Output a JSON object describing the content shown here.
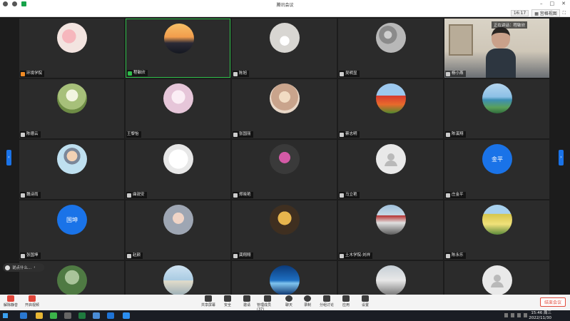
{
  "window": {
    "title": "腾讯会议"
  },
  "topbar": {
    "time": "16:17",
    "view_label": "宫格视图"
  },
  "speaking": {
    "label": "正在讲话：程敏欣"
  },
  "participants": [
    {
      "name": "环境学院",
      "avatar": "pigs",
      "mic": "orange"
    },
    {
      "name": "程敏欣",
      "avatar": "sunset",
      "mic": "green",
      "speaking": true
    },
    {
      "name": "陈旭",
      "avatar": "shell",
      "mic": "gray"
    },
    {
      "name": "吴明显",
      "avatar": "rocks",
      "mic": "gray"
    },
    {
      "name": "杨小燕",
      "avatar": "video",
      "mic": "gray"
    },
    {
      "name": "陈德云",
      "avatar": "flowers",
      "mic": "gray"
    },
    {
      "name": "王黎怡",
      "avatar": "girl",
      "mic": "none"
    },
    {
      "name": "张国丽",
      "avatar": "woman-hat",
      "mic": "gray"
    },
    {
      "name": "蔡志明",
      "avatar": "tulips",
      "mic": "gray"
    },
    {
      "name": "陈溪翔",
      "avatar": "lake",
      "mic": "gray"
    },
    {
      "name": "魏诗雨",
      "avatar": "cartoon-man",
      "mic": "gray"
    },
    {
      "name": "曲锐安",
      "avatar": "cartoon-cat",
      "mic": "gray"
    },
    {
      "name": "郑晓艳",
      "avatar": "orchid",
      "mic": "gray"
    },
    {
      "name": "马立艳",
      "avatar": "placeholder",
      "mic": "gray"
    },
    {
      "name": "庄金平",
      "avatar": "text",
      "avatar_text": "金平",
      "mic": "gray"
    },
    {
      "name": "张国坤",
      "avatar": "text",
      "avatar_text": "国坤",
      "mic": "gray"
    },
    {
      "name": "赵颜",
      "avatar": "baby",
      "mic": "gray"
    },
    {
      "name": "龚翔翔",
      "avatar": "kid",
      "mic": "gray"
    },
    {
      "name": "土木学院-刘祥",
      "avatar": "train",
      "mic": "gray"
    },
    {
      "name": "陈永乐",
      "avatar": "bus",
      "mic": "gray"
    },
    {
      "name": "",
      "avatar": "trees",
      "mic": "none"
    },
    {
      "name": "",
      "avatar": "landscape",
      "mic": "none"
    },
    {
      "name": "",
      "avatar": "ocean",
      "mic": "none"
    },
    {
      "name": "",
      "avatar": "street",
      "mic": "none"
    },
    {
      "name": "",
      "avatar": "placeholder",
      "mic": "none"
    }
  ],
  "side_panel": {
    "label": "说点什么..."
  },
  "toolbar": {
    "left": [
      {
        "label": "解除静音"
      },
      {
        "label": "开启视频"
      }
    ],
    "center": [
      {
        "label": "共享屏幕"
      },
      {
        "label": "安全"
      },
      {
        "label": "邀请"
      },
      {
        "label": "管理成员(37)"
      },
      {
        "label": "聊天"
      },
      {
        "label": "录制"
      },
      {
        "label": "分组讨论"
      },
      {
        "label": "应用"
      },
      {
        "label": "设置"
      }
    ],
    "end_label": "结束会议"
  },
  "taskbar": {
    "time": "15:46 周三",
    "date": "2022/11/30"
  },
  "colors": {
    "accent": "#1a73e8",
    "speaking": "#2fbf4a",
    "end": "#e24b3b"
  }
}
